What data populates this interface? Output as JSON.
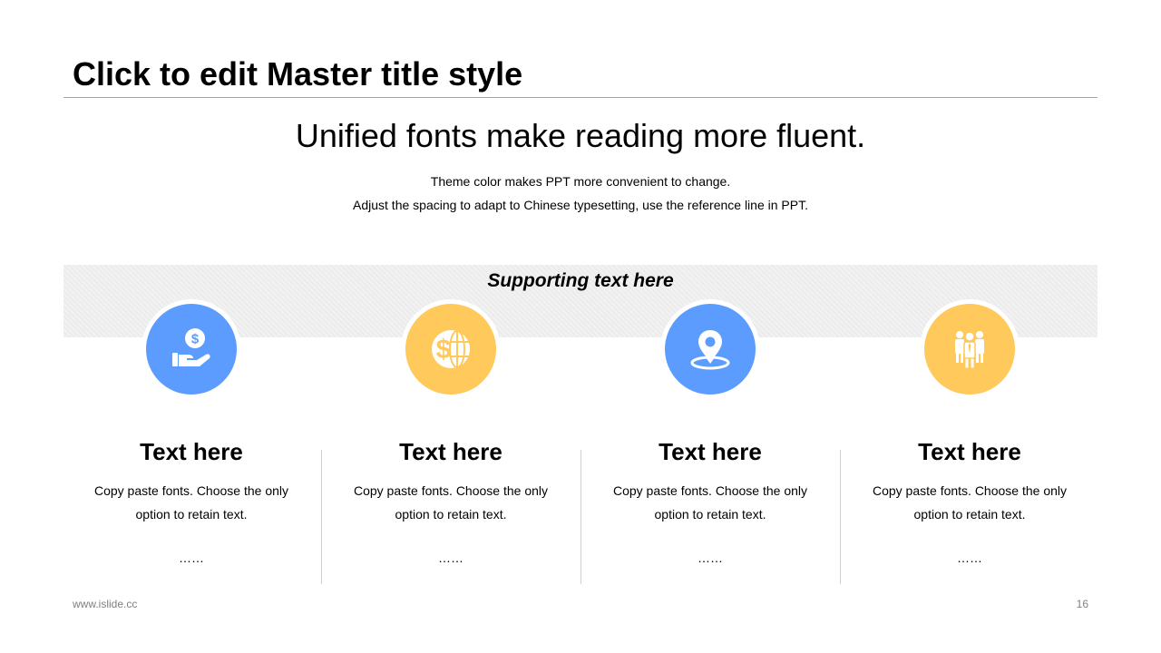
{
  "slide": {
    "master_title": "Click to edit Master title style",
    "headline": "Unified fonts make reading more fluent.",
    "subtitle_lines": [
      "Theme color makes PPT more convenient  to change.",
      "Adjust  the spacing to adapt to Chinese  typesetting,  use  the reference line  in PPT."
    ],
    "band_text": "Supporting text here"
  },
  "features": [
    {
      "icon": "hand-dollar-icon",
      "color": "#5b9cfe",
      "title": "Text here",
      "body": "Copy paste fonts. Choose the only option to retain text.",
      "ellipsis": "……"
    },
    {
      "icon": "globe-dollar-icon",
      "color": "#ffc95b",
      "title": "Text here",
      "body": "Copy paste fonts. Choose the only option to retain text.",
      "ellipsis": "……"
    },
    {
      "icon": "location-pin-icon",
      "color": "#5b9cfe",
      "title": "Text here",
      "body": "Copy paste fonts. Choose the only option to retain text.",
      "ellipsis": "……"
    },
    {
      "icon": "team-icon",
      "color": "#ffc95b",
      "title": "Text here",
      "body": "Copy paste fonts. Choose the only option to retain text.",
      "ellipsis": "……"
    }
  ],
  "footer": {
    "url": "www.islide.cc",
    "page_number": "16"
  },
  "colors": {
    "blue": "#5b9cfe",
    "yellow": "#ffc95b",
    "rule": "#a6a6a6",
    "band": "#f1f1f1",
    "footer_text": "#7f7f7f"
  }
}
